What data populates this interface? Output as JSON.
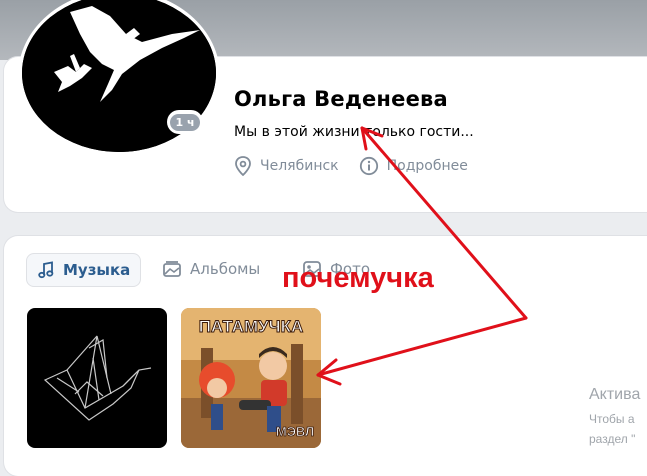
{
  "profile": {
    "name": "Ольга Веденеева",
    "status": "Мы в этой жизни только гости...",
    "online_ago": "1 ч",
    "city": "Челябинск",
    "details_link": "Подробнее"
  },
  "tabs": [
    {
      "label": "Музыка",
      "icon": "music-note-icon",
      "active": true
    },
    {
      "label": "Альбомы",
      "icon": "albums-icon",
      "active": false
    },
    {
      "label": "Фото",
      "icon": "photo-icon",
      "active": false
    }
  ],
  "thumbnails": [
    {
      "name": "paper-crane-cover"
    },
    {
      "name": "patamuchka-cover",
      "title_text": "ПАТАМУЧКА",
      "artist_text": "МЭВЛ"
    }
  ],
  "annotation": {
    "text": "почемучка",
    "color": "#e0101a"
  },
  "windows_watermark": {
    "line1": "Актива",
    "line2": "Чтобы а",
    "line3": "раздел \""
  },
  "colors": {
    "link": "#2c5d8f",
    "secondary": "#818c99",
    "card": "#ffffff",
    "page": "#ebedf0"
  }
}
